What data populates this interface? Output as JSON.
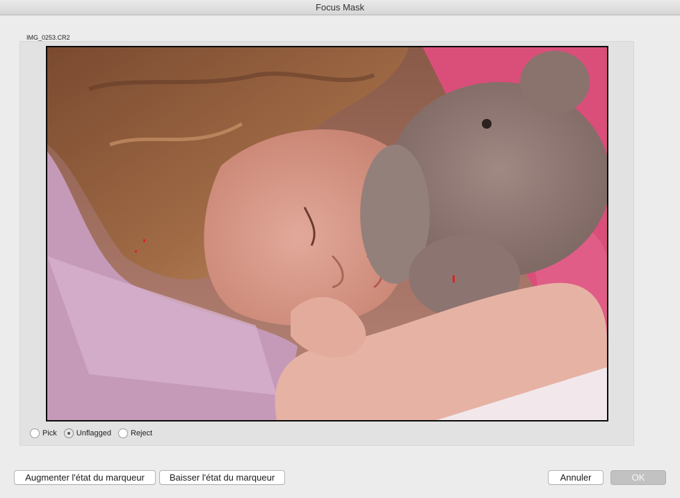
{
  "window": {
    "title": "Focus Mask"
  },
  "image": {
    "filename": "IMG_0253.CR2"
  },
  "flags": {
    "options": [
      {
        "label": "Pick",
        "selected": false
      },
      {
        "label": "Unflagged",
        "selected": true
      },
      {
        "label": "Reject",
        "selected": false
      }
    ]
  },
  "buttons": {
    "increase_flag": "Augmenter l'état du marqueur",
    "decrease_flag": "Baisser l'état du marqueur",
    "cancel": "Annuler",
    "ok": "OK"
  },
  "colors": {
    "focus_mask_marker": "#e02020"
  }
}
